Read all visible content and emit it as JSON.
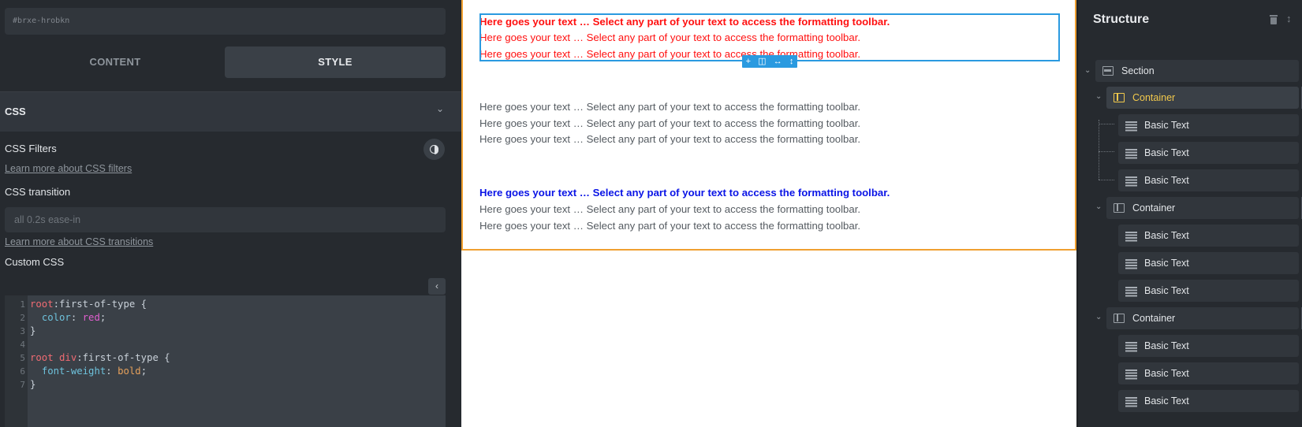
{
  "left_panel": {
    "element_id": "#brxe-hrobkn",
    "tabs": [
      {
        "label": "CONTENT",
        "active": false
      },
      {
        "label": "STYLE",
        "active": true
      }
    ],
    "css_section": {
      "title": "CSS",
      "filters_label": "CSS Filters",
      "filters_link": "Learn more about CSS filters",
      "transition_label": "CSS transition",
      "transition_placeholder": "all 0.2s ease-in",
      "transition_link": "Learn more about CSS transitions",
      "custom_label": "Custom CSS"
    },
    "code": [
      {
        "n": "1",
        "text": "root:first-of-type {"
      },
      {
        "n": "2",
        "text": "  color: red;"
      },
      {
        "n": "3",
        "text": "}"
      },
      {
        "n": "4",
        "text": ""
      },
      {
        "n": "5",
        "text": "root div:first-of-type {"
      },
      {
        "n": "6",
        "text": "  font-weight: bold;"
      },
      {
        "n": "7",
        "text": "}"
      }
    ]
  },
  "canvas": {
    "text_line": "Here goes your text … Select any part of your text to access the formatting toolbar.",
    "colors": {
      "red": "#ff1010",
      "blue": "#0a14e6",
      "gray": "#555b61",
      "selection": "#2a9ae0",
      "section_border": "#f0a030"
    },
    "toolbar_icons": [
      "plus-icon",
      "columns-icon",
      "width-icon",
      "height-icon"
    ]
  },
  "structure": {
    "title": "Structure",
    "nodes": [
      {
        "label": "Section",
        "type": "section"
      },
      {
        "label": "Container",
        "type": "container",
        "active": true
      },
      {
        "label": "Basic Text",
        "type": "text"
      },
      {
        "label": "Basic Text",
        "type": "text"
      },
      {
        "label": "Basic Text",
        "type": "text"
      },
      {
        "label": "Container",
        "type": "container"
      },
      {
        "label": "Basic Text",
        "type": "text"
      },
      {
        "label": "Basic Text",
        "type": "text"
      },
      {
        "label": "Basic Text",
        "type": "text"
      },
      {
        "label": "Container",
        "type": "container"
      },
      {
        "label": "Basic Text",
        "type": "text"
      },
      {
        "label": "Basic Text",
        "type": "text"
      },
      {
        "label": "Basic Text",
        "type": "text"
      }
    ]
  }
}
